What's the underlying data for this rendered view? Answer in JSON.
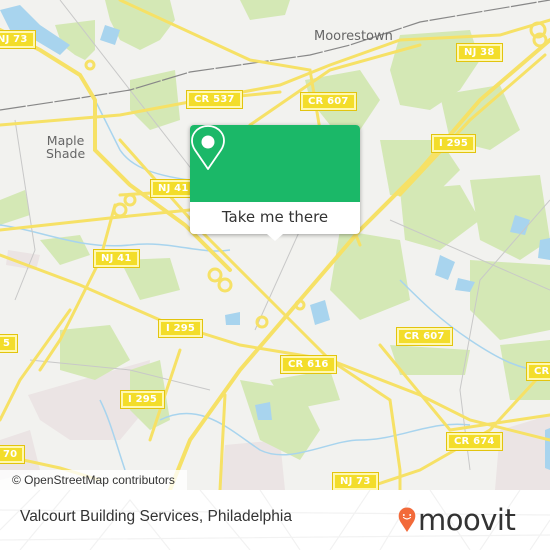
{
  "map": {
    "place_labels": {
      "moorestown": "Moorestown",
      "maple_shade_line1": "Maple",
      "maple_shade_line2": "Shade"
    },
    "road_shields": [
      {
        "id": "nj73-top",
        "label": "NJ 73"
      },
      {
        "id": "nj38",
        "label": "NJ 38"
      },
      {
        "id": "cr537",
        "label": "CR 537"
      },
      {
        "id": "cr607-top",
        "label": "CR 607"
      },
      {
        "id": "i295-right",
        "label": "I 295"
      },
      {
        "id": "nj41-top",
        "label": "NJ 41"
      },
      {
        "id": "nj41-left",
        "label": "NJ 41"
      },
      {
        "id": "i295-center",
        "label": "I 295"
      },
      {
        "id": "cr607-right",
        "label": "CR 607"
      },
      {
        "id": "cr616",
        "label": "CR 616"
      },
      {
        "id": "i295-lower",
        "label": "I 295"
      },
      {
        "id": "cr674",
        "label": "CR 674"
      },
      {
        "id": "nj73-bottom",
        "label": "NJ 73"
      },
      {
        "id": "edge-left-mid",
        "label": "5"
      },
      {
        "id": "edge-left-bottom",
        "label": "70"
      },
      {
        "id": "edge-right",
        "label": "CR"
      }
    ],
    "attribution": "© OpenStreetMap contributors",
    "colors": {
      "land": "#f2f2ef",
      "park": "#d4e8b5",
      "water": "#a8d4ee",
      "road": "#f6e166",
      "residential": "#ebe4e4"
    }
  },
  "popup": {
    "icon": "map-pin-icon",
    "button_label": "Take me there",
    "accent_color": "#1bb868"
  },
  "footer": {
    "title": "Valcourt Building Services, Philadelphia",
    "logo_text": "moovit",
    "logo_icon": "moovit-pin-smile-icon",
    "logo_color": "#f26a3a"
  }
}
